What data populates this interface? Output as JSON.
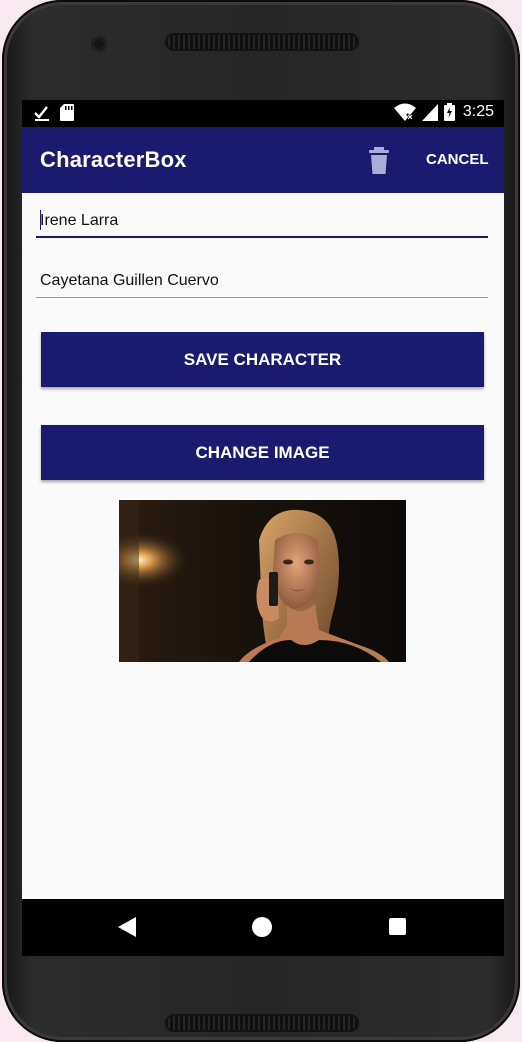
{
  "status_bar": {
    "time": "3:25",
    "left_icons": [
      "download-done-icon",
      "sd-card-icon"
    ],
    "right_icons": [
      "wifi-icon",
      "signal-icon",
      "battery-charging-icon"
    ]
  },
  "app_bar": {
    "title": "CharacterBox",
    "delete_icon": "trash-icon",
    "cancel_label": "CANCEL",
    "color": "#1a1a6e"
  },
  "form": {
    "name_value": "Irene Larra",
    "actor_value": "Cayetana Guillen Cuervo",
    "save_label": "SAVE CHARACTER",
    "change_image_label": "CHANGE IMAGE"
  },
  "image": {
    "icon": "character-photo",
    "description_icon": "woman-on-phone-photo"
  },
  "nav_bar": {
    "icons": [
      "back-icon",
      "home-icon",
      "recents-icon"
    ]
  }
}
